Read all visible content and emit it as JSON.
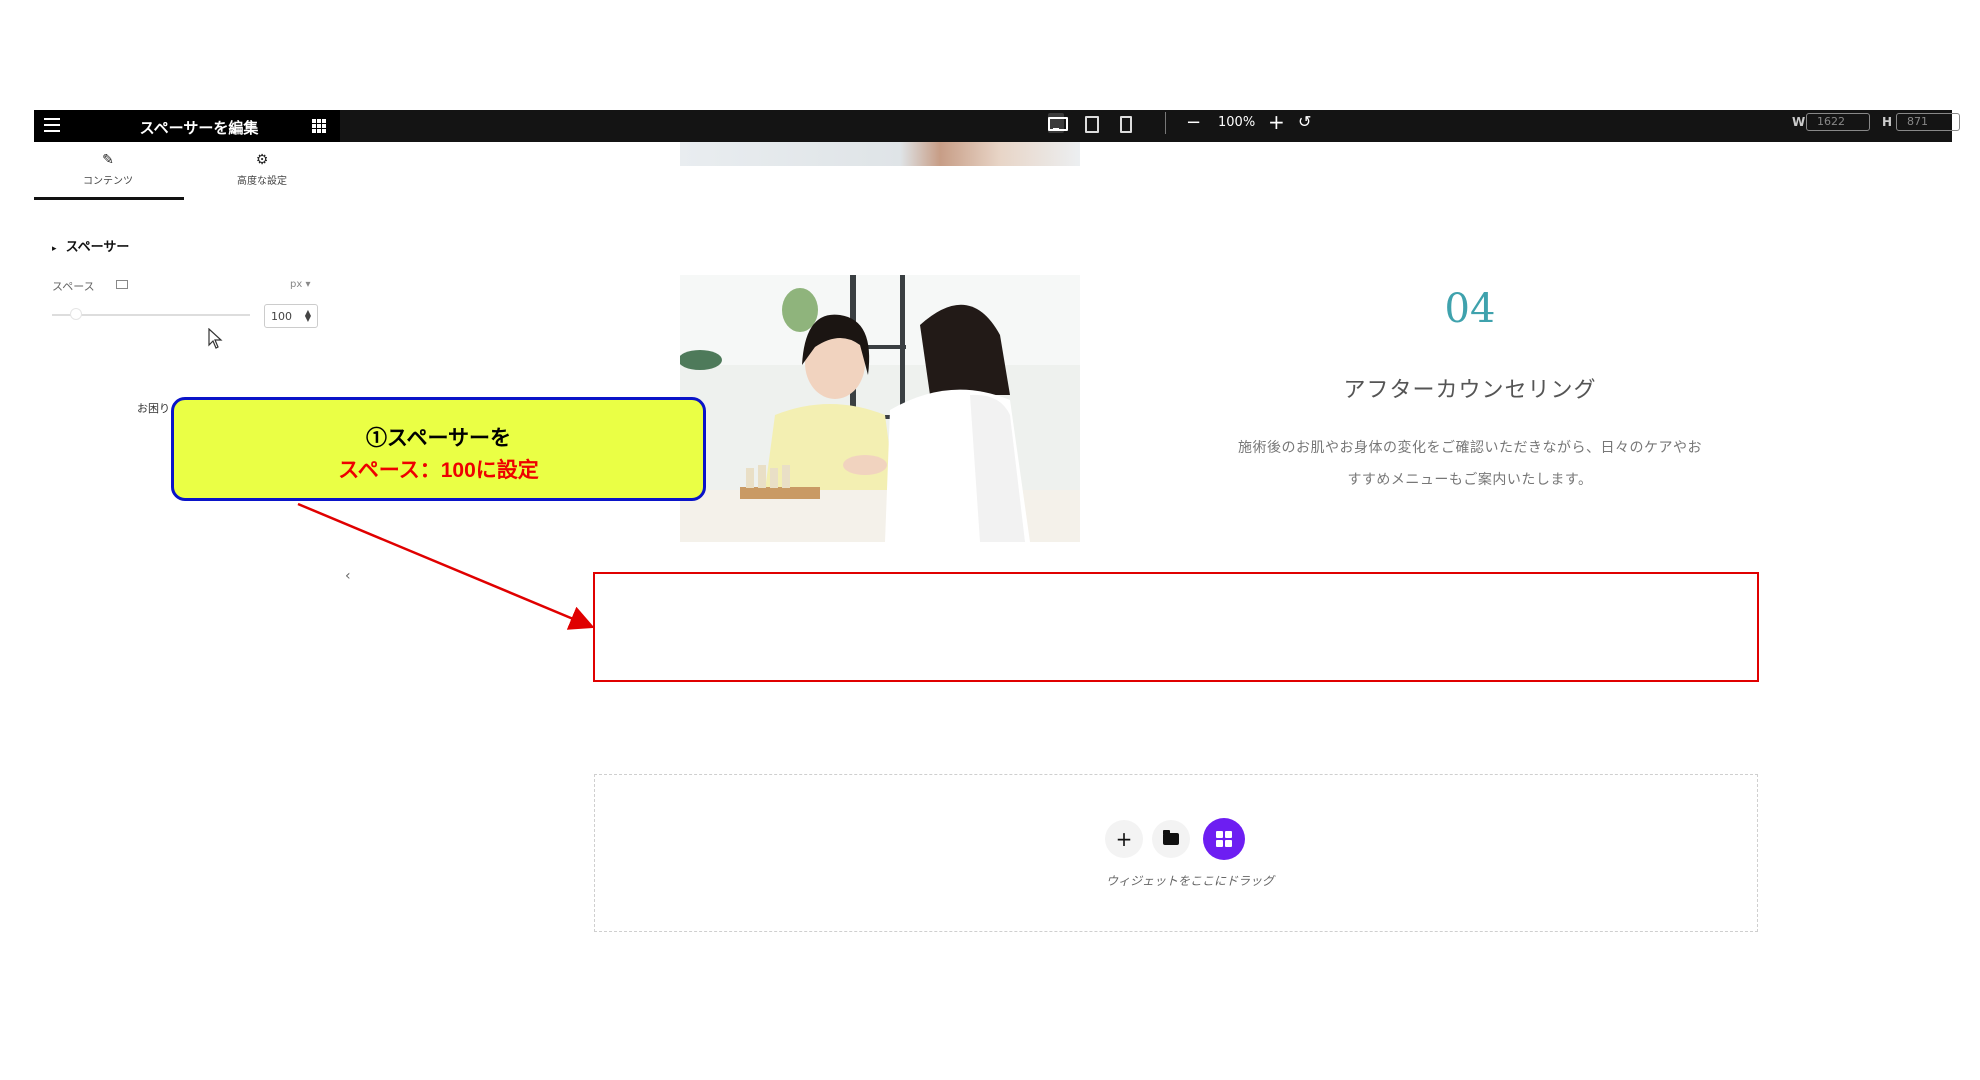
{
  "editor": {
    "panel_title": "スペーサーを編集",
    "zoom": "100%",
    "width_label": "W",
    "width_value": "1622",
    "height_label": "H",
    "height_value": "871"
  },
  "panel": {
    "tabs": [
      {
        "label": "コンテンツ",
        "icon": "pencil-icon"
      },
      {
        "label": "高度な設定",
        "icon": "gear-icon"
      }
    ],
    "section_title": "スペーサー",
    "space_label": "スペース",
    "unit": "px",
    "space_value": "100",
    "slider_fraction": 0.12,
    "help_text": "お困り"
  },
  "content": {
    "step_number": "04",
    "step_title": "アフターカウンセリング",
    "step_desc_line1": "施術後のお肌やお身体の変化をご確認いただきながら、日々のケアやお",
    "step_desc_line2": "すすめメニューもご案内いたします。"
  },
  "drop_zone": {
    "label": "ウィジェットをここにドラッグ"
  },
  "annotation": {
    "line1": "①スペーサーを",
    "line2": "スペース：100に設定",
    "fill_color": "#eaff45",
    "border_color": "#0a14c8",
    "highlight_color": "#e00000"
  },
  "colors": {
    "accent_teal": "#3fa2ad",
    "widget_kit_purple": "#6d1ef2"
  }
}
